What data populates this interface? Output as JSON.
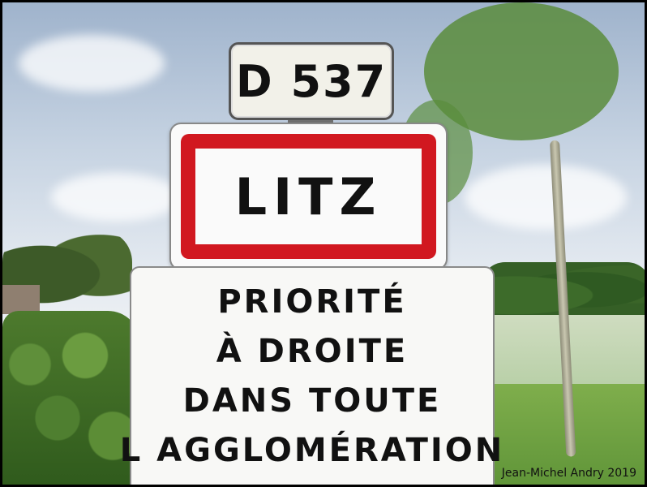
{
  "route_sign": {
    "text": "D 537"
  },
  "town_sign": {
    "name": "LITZ",
    "border_color": "#d11820"
  },
  "priority_sign": {
    "lines": [
      "PRIORITÉ",
      "À DROITE",
      "DANS TOUTE",
      "L AGGLOMÉRATION"
    ]
  },
  "photo_credit": "Jean-Michel Andry 2019"
}
